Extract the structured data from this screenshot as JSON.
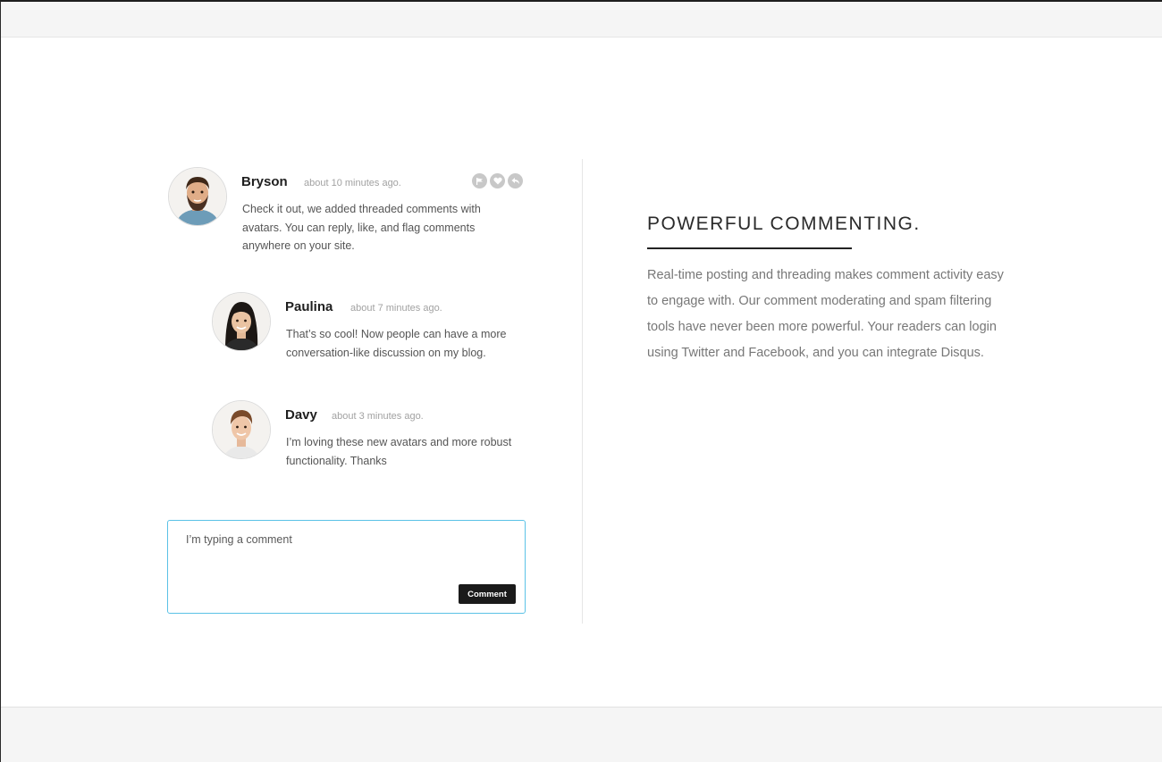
{
  "comments": [
    {
      "name": "Bryson",
      "time": "about 10 minutes ago.",
      "text": "Check it out, we added threaded comments with avatars. You can reply, like, and flag comments anywhere on your site."
    },
    {
      "name": "Paulina",
      "time": "about 7 minutes ago.",
      "text": "That’s so cool! Now people can have a more conversation-like discussion on my blog."
    },
    {
      "name": "Davy",
      "time": "about 3 minutes ago.",
      "text": "I’m loving these new avatars and more robust functionality. Thanks"
    }
  ],
  "actions": {
    "icons": [
      "flag-icon",
      "heart-icon",
      "reply-icon"
    ]
  },
  "composer": {
    "value": "I’m typing a comment",
    "button_label": "Comment"
  },
  "feature": {
    "headline": "POWERFUL COMMENTING.",
    "body": "Real-time posting and threading makes comment activity easy to engage with. Our comment moderating and spam filtering tools have never been more powerful. Your readers can login using Twitter and Facebook, and you can integrate Disqus."
  },
  "colors": {
    "accent_border": "#5bc2e6",
    "button_bg": "#1a1a1a",
    "band_bg": "#f5f5f5"
  }
}
